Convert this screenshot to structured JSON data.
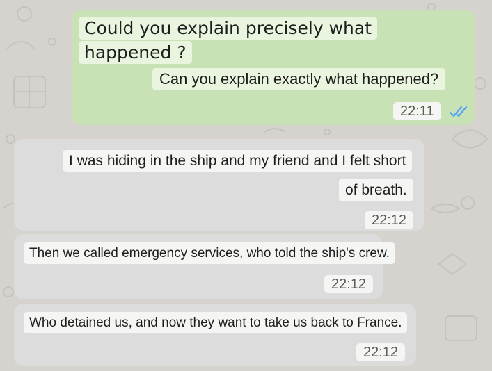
{
  "colors": {
    "background": "#d6d3cf",
    "outgoing_bubble": "#c9e2b5",
    "incoming_bubble": "#dcdcdc",
    "read_ticks": "#4fa3f7"
  },
  "messages": [
    {
      "direction": "outgoing",
      "original_lines": [
        "Could you explain precisely what",
        "happened ?"
      ],
      "translation": "Can you explain exactly what happened?",
      "time": "22:11",
      "status_icon": "double-check-read-icon"
    },
    {
      "direction": "incoming",
      "lines": [
        "I was hiding in the ship and my friend and I felt short",
        "of breath."
      ],
      "time": "22:12"
    },
    {
      "direction": "incoming",
      "lines": [
        "Then we called emergency services, who told the ship's crew."
      ],
      "time": "22:12"
    },
    {
      "direction": "incoming",
      "lines": [
        "Who detained us, and now they want to take us back to France."
      ],
      "time": "22:12"
    }
  ]
}
